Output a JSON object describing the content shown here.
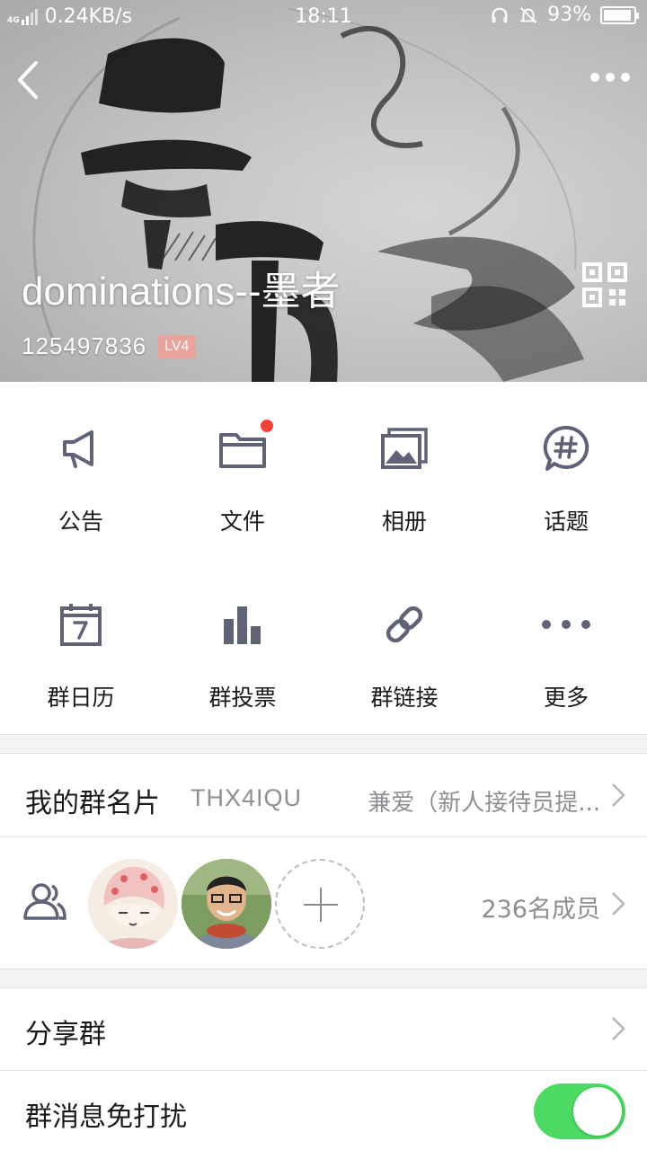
{
  "status_bar": {
    "network": "4G",
    "speed": "0.24KB/s",
    "time": "18:11",
    "battery": "93%",
    "icons": [
      "signal-icon",
      "headphones-icon",
      "mute-bell-icon",
      "battery-icon"
    ]
  },
  "header": {
    "group_name": "dominations--墨者",
    "group_id": "125497836",
    "level_badge": "LV4",
    "colors": {
      "level_badge_bg": "#e9a39a"
    },
    "icons": [
      "back-arrow-icon",
      "more-dots-icon",
      "qr-code-icon"
    ]
  },
  "features": [
    {
      "label": "公告",
      "icon": "megaphone-icon"
    },
    {
      "label": "文件",
      "icon": "folder-icon",
      "has_dot": true
    },
    {
      "label": "相册",
      "icon": "album-icon"
    },
    {
      "label": "话题",
      "icon": "hashtag-bubble-icon"
    },
    {
      "label": "群日历",
      "icon": "calendar-icon"
    },
    {
      "label": "群投票",
      "icon": "bar-chart-icon"
    },
    {
      "label": "群链接",
      "icon": "link-icon"
    },
    {
      "label": "更多",
      "icon": "more-icon"
    }
  ],
  "card": {
    "title": "我的群名片",
    "nickname": "THX4IQU",
    "value": "兼爱（新人接待员提..."
  },
  "members": {
    "count_label": "236名成员",
    "icons": [
      "members-icon",
      "add-member-icon"
    ]
  },
  "share": {
    "title": "分享群"
  },
  "dnd": {
    "title": "群消息免打扰",
    "enabled": true
  },
  "colors": {
    "accent_green": "#4cd964",
    "icon_gray": "#5f6377",
    "red_dot": "#f44336"
  }
}
